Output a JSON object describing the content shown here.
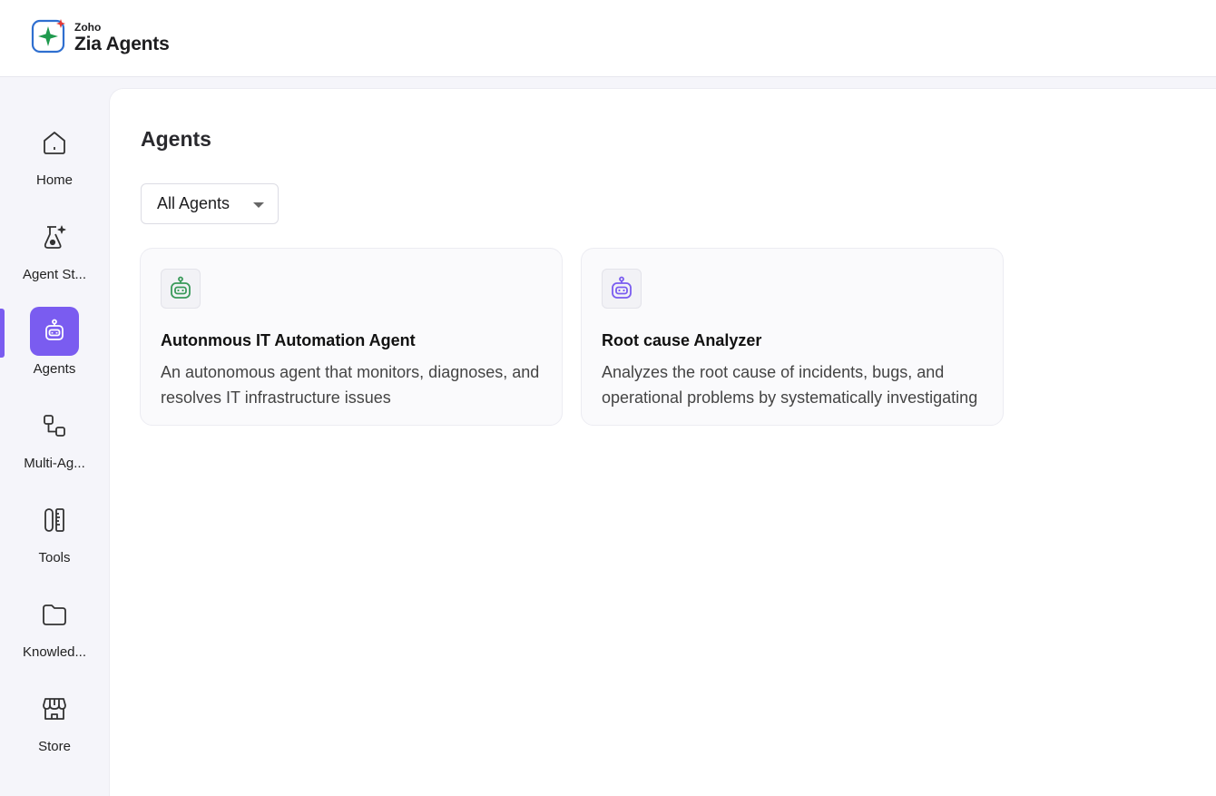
{
  "header": {
    "brand": "Zoho",
    "product": "Zia Agents"
  },
  "sidebar": {
    "items": [
      {
        "label": "Home",
        "icon": "home-icon"
      },
      {
        "label": "Agent St...",
        "icon": "agent-studio-icon"
      },
      {
        "label": "Agents",
        "icon": "robot-icon",
        "active": true
      },
      {
        "label": "Multi-Ag...",
        "icon": "workflow-icon"
      },
      {
        "label": "Tools",
        "icon": "tools-icon"
      },
      {
        "label": "Knowled...",
        "icon": "folder-icon"
      },
      {
        "label": "Store",
        "icon": "store-icon"
      }
    ]
  },
  "main": {
    "title": "Agents",
    "filter": {
      "selected": "All Agents"
    },
    "cards": [
      {
        "title": "Autonmous IT Automation Agent",
        "description": "An autonomous agent that monitors, diagnoses, and resolves IT infrastructure issues",
        "icon": "robot-icon",
        "icon_color": "#3a9a5a"
      },
      {
        "title": "Root cause Analyzer",
        "description": "Analyzes the root cause of incidents, bugs, and operational problems by systematically investigating",
        "icon": "robot-icon",
        "icon_color": "#7a5cf0"
      }
    ]
  },
  "colors": {
    "accent": "#7a5cf0",
    "sidebar_bg": "#f5f5fa",
    "card_bg": "#fafafc"
  }
}
